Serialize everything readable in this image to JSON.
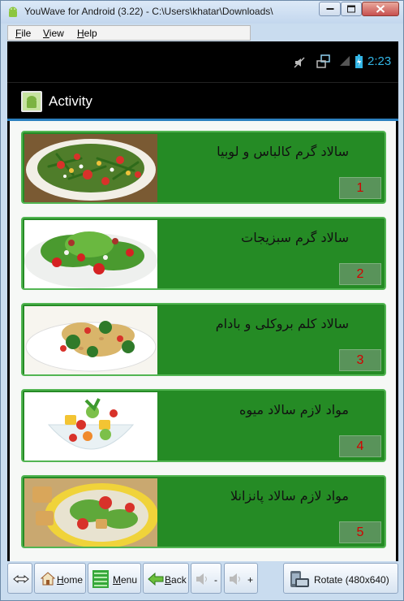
{
  "window": {
    "title": "YouWave for Android (3.22) - C:\\Users\\khatar\\Downloads\\"
  },
  "menu": [
    {
      "label": "File",
      "mnemonic": "F",
      "rest": "ile"
    },
    {
      "label": "View",
      "mnemonic": "V",
      "rest": "iew"
    },
    {
      "label": "Help",
      "mnemonic": "H",
      "rest": "elp"
    }
  ],
  "statusbar": {
    "time": "2:23",
    "icons": [
      "mute-icon",
      "network-icon",
      "signal-icon",
      "battery-icon"
    ]
  },
  "actionbar": {
    "title": "Activity",
    "icon": "android-app-icon"
  },
  "colors": {
    "card_bg": "#258b25",
    "card_border": "#52b552",
    "number_color": "#d40000",
    "accent_blue": "#33b5e5"
  },
  "items": [
    {
      "title": "سالاد گرم کالباس و لوبیا",
      "number": "1"
    },
    {
      "title": "سالاد گرم سبزیجات",
      "number": "2"
    },
    {
      "title": "سالاد کلم بروکلی و بادام",
      "number": "3"
    },
    {
      "title": "مواد لازم سالاد میوه",
      "number": "4"
    },
    {
      "title": "مواد لازم سالاد پانزانلا",
      "number": "5"
    }
  ],
  "toolbar": {
    "home": {
      "mnemonic": "H",
      "rest": "ome"
    },
    "menu": {
      "mnemonic": "M",
      "rest": "enu"
    },
    "back": {
      "mnemonic": "B",
      "rest": "ack"
    },
    "vol_down": "-",
    "vol_up": "+",
    "rotate": "Rotate (480x640)"
  }
}
